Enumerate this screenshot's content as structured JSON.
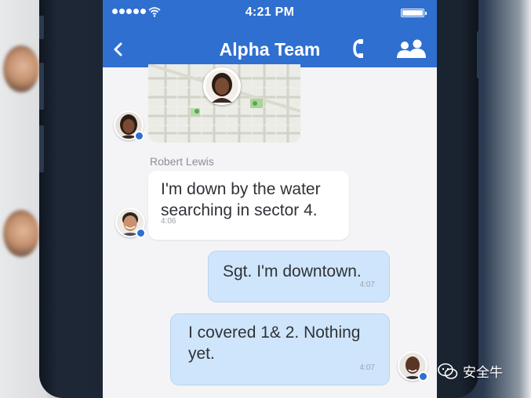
{
  "status_bar": {
    "time": "4:21 PM"
  },
  "nav": {
    "title": "Alpha Team",
    "back_icon": "chevron-left-icon",
    "call_icon": "phone-icon",
    "members_icon": "group-icon"
  },
  "messages": [
    {
      "sender": "Robert Lewis",
      "text": "I'm down by the water searching in sector 4.",
      "time": "4:06",
      "direction": "incoming"
    },
    {
      "text": "Sgt. I'm downtown.",
      "time": "4:07",
      "direction": "outgoing"
    },
    {
      "text": "I covered 1& 2. Nothing yet.",
      "time": "4:07",
      "direction": "outgoing"
    }
  ],
  "watermark": {
    "text": "安全牛"
  },
  "colors": {
    "nav_blue": "#2f6fd0",
    "outgoing_bubble": "#cfe5fb",
    "incoming_bubble": "#ffffff"
  }
}
